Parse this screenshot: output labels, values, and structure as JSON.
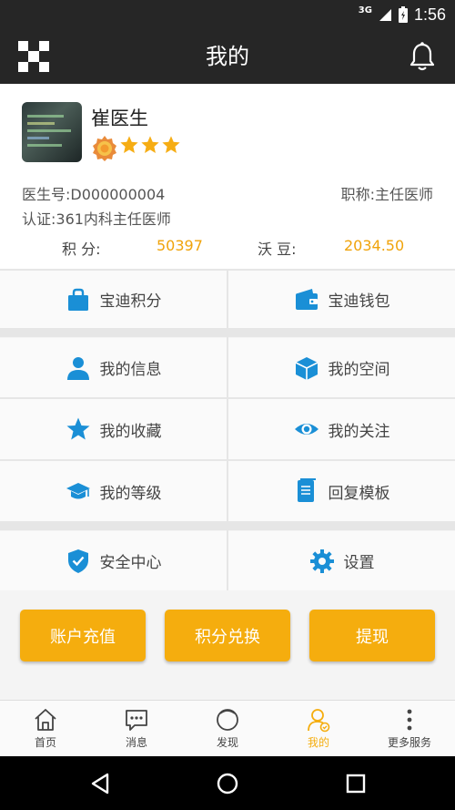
{
  "status_bar": {
    "network": "3G",
    "time": "1:56"
  },
  "header": {
    "title": "我的"
  },
  "profile": {
    "name": "崔医生",
    "doctor_no": "医生号:D000000004",
    "job_title": "职称:主任医师",
    "certification": "认证:361内科主任医师",
    "points_label": "积 分:",
    "points_value": "50397",
    "beans_label": "沃 豆:",
    "beans_value": "2034.50",
    "stars": 3
  },
  "menu": {
    "baodi_points": "宝迪积分",
    "baodi_wallet": "宝迪钱包",
    "my_info": "我的信息",
    "my_space": "我的空间",
    "my_favorites": "我的收藏",
    "my_follows": "我的关注",
    "my_level": "我的等级",
    "reply_templates": "回复模板",
    "security_center": "安全中心",
    "settings": "设置"
  },
  "actions": {
    "recharge": "账户充值",
    "exchange": "积分兑换",
    "withdraw": "提现"
  },
  "bottom_nav": {
    "items": [
      {
        "label": "首页",
        "icon": "home-icon"
      },
      {
        "label": "消息",
        "icon": "message-icon"
      },
      {
        "label": "发现",
        "icon": "discover-icon"
      },
      {
        "label": "我的",
        "icon": "profile-icon",
        "active": true
      },
      {
        "label": "更多服务",
        "icon": "more-icon"
      }
    ]
  },
  "colors": {
    "accent": "#f5ad0e",
    "icon_blue": "#1a8fd6",
    "header_bg": "#262626"
  }
}
